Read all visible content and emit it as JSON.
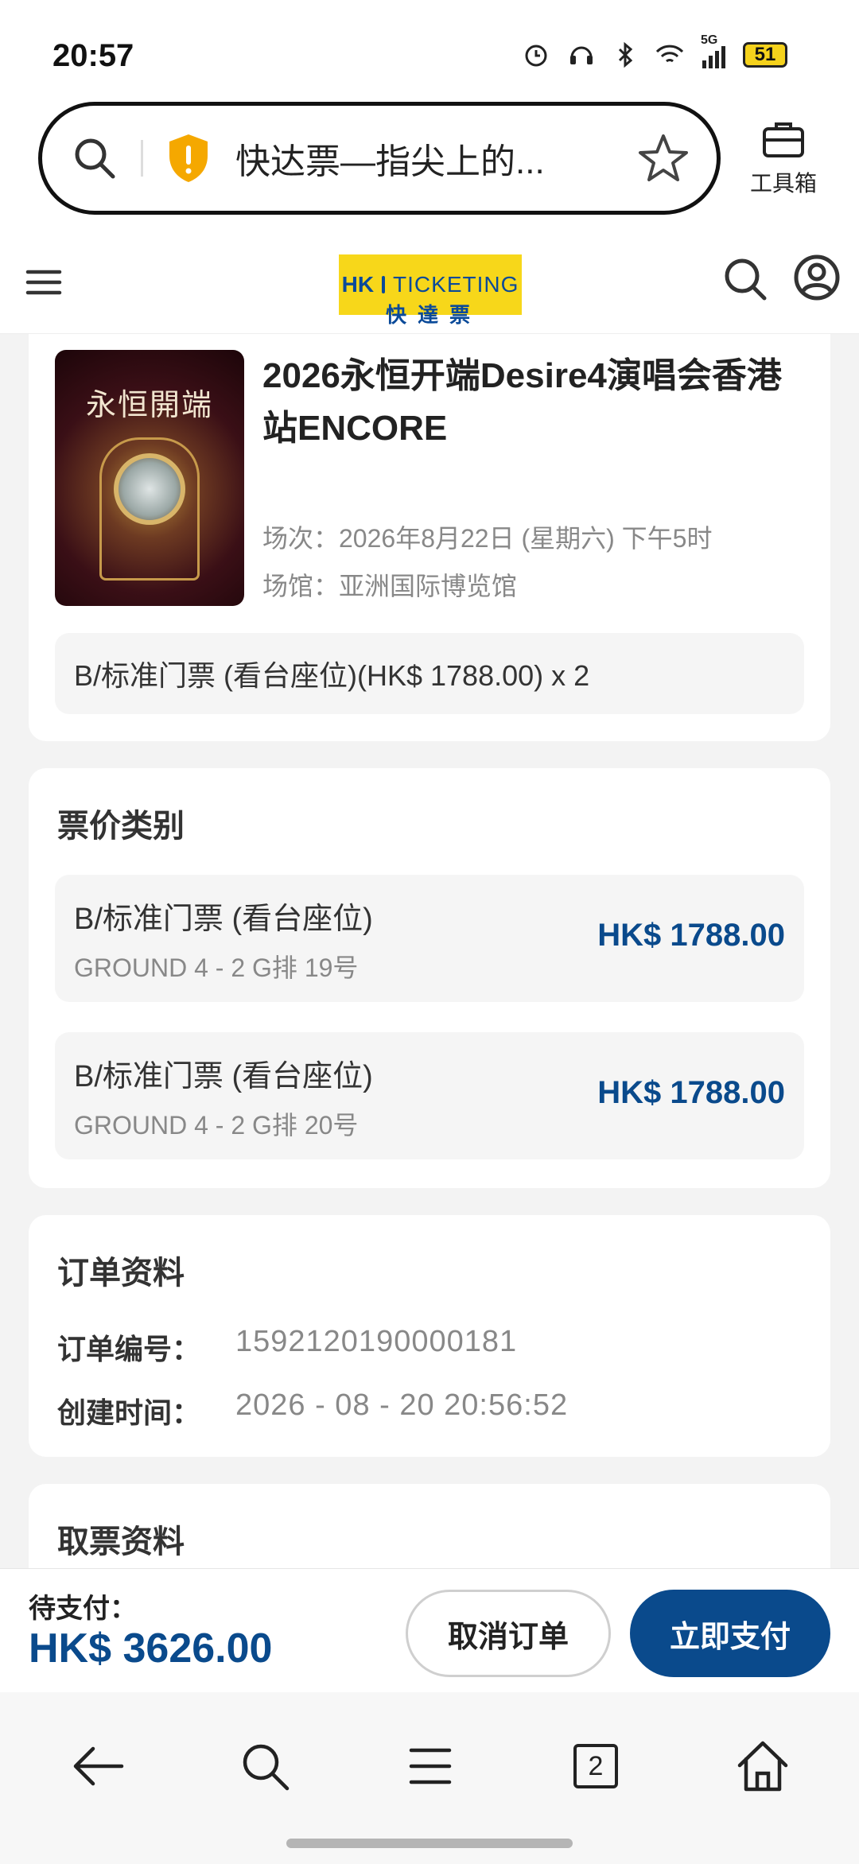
{
  "status_bar": {
    "time": "20:57",
    "network": "5G",
    "battery": "51",
    "icons": [
      "alarm-icon",
      "headset-icon",
      "bluetooth-icon",
      "wifi-icon",
      "signal-icon",
      "battery-icon"
    ]
  },
  "browser": {
    "url_title": "快达票—指尖上的...",
    "toolbox_label": "工具箱",
    "icons": [
      "search-icon",
      "shield-warning-icon",
      "star-icon",
      "toolbox-icon"
    ]
  },
  "site_header": {
    "logo_hk": "HK",
    "logo_ticketing": "TICKETING",
    "logo_cn": "快達票",
    "icons": [
      "menu-icon",
      "search-icon",
      "account-icon"
    ]
  },
  "event": {
    "poster_title": "永恒開端",
    "title": "2026永恒开端Desire4演唱会香港站ENCORE",
    "session": "场次：2026年8月22日 (星期六) 下午5时",
    "venue": "场馆：亚洲国际博览馆",
    "ticket_summary": "B/标准门票 (看台座位)(HK$ 1788.00) x 2"
  },
  "price_section": {
    "title": "票价类别",
    "items": [
      {
        "name": "B/标准门票 (看台座位)",
        "seat": "GROUND 4 - 2 G排 19号",
        "price": "HK$ 1788.00"
      },
      {
        "name": "B/标准门票 (看台座位)",
        "seat": "GROUND 4 - 2 G排 20号",
        "price": "HK$ 1788.00"
      }
    ]
  },
  "order_section": {
    "title": "订单资料",
    "order_no_label": "订单编号：",
    "order_no": "1592120190000181",
    "created_label": "创建时间：",
    "created": "2026 - 08 - 20 20:56:52"
  },
  "pickup_section": {
    "title": "取票资料"
  },
  "pay_bar": {
    "label": "待支付：",
    "amount": "HK$ 3626.00",
    "cancel_label": "取消订单",
    "pay_label": "立即支付"
  },
  "bottom_nav": {
    "tab_count": "2",
    "icons": [
      "back-icon",
      "search-icon",
      "menu-icon",
      "tabs-icon",
      "home-icon"
    ]
  },
  "colors": {
    "brand_blue": "#0a4a8c",
    "logo_yellow": "#f7d71a"
  }
}
